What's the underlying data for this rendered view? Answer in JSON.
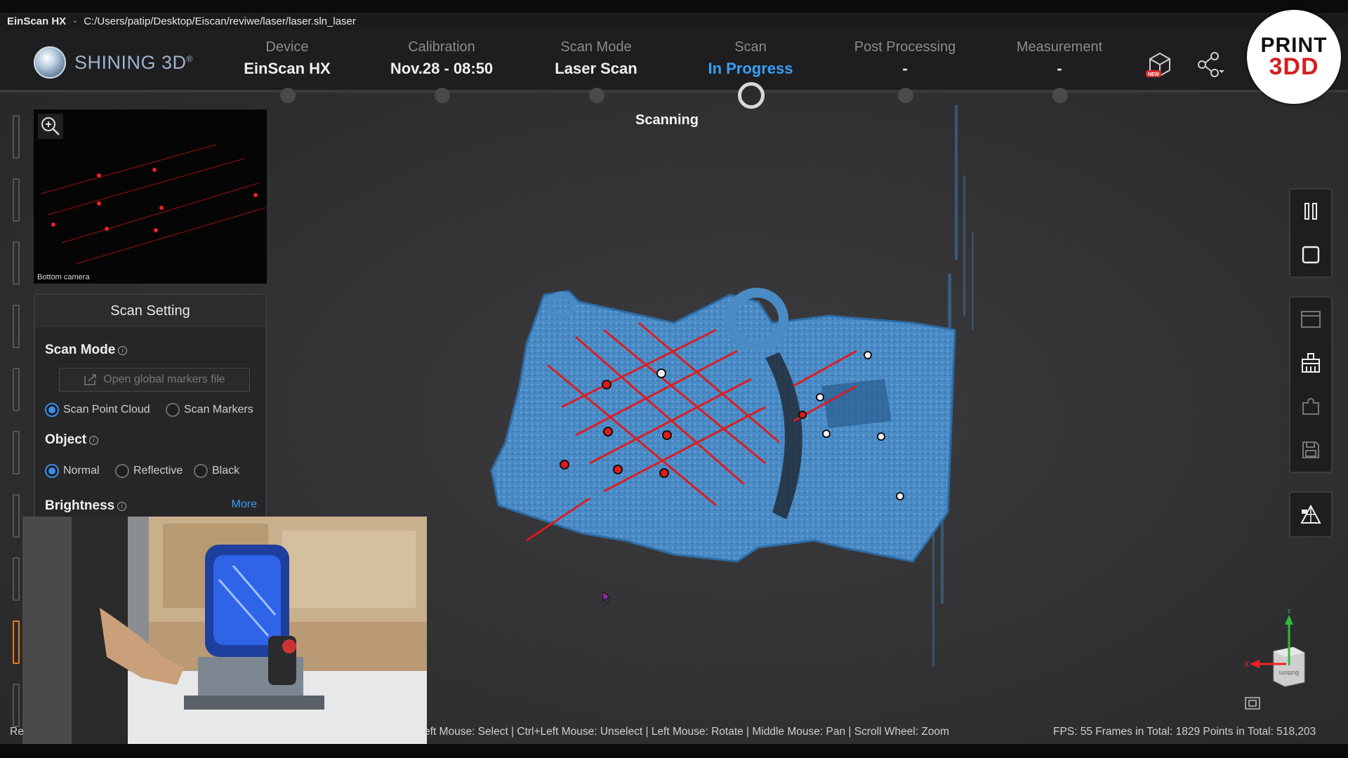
{
  "titlebar": {
    "app": "EinScan HX",
    "separator": "-",
    "path": "C:/Users/patip/Desktop/Eiscan/reviwe/laser/laser.sln_laser",
    "minimize": "—"
  },
  "brand": {
    "name": "SHINING 3D",
    "reg": "®"
  },
  "steps": [
    {
      "label": "Device",
      "value": "EinScan HX"
    },
    {
      "label": "Calibration",
      "value": "Nov.28 - 08:50"
    },
    {
      "label": "Scan Mode",
      "value": "Laser Scan"
    },
    {
      "label": "Scan",
      "value": "In Progress",
      "active": true
    },
    {
      "label": "Post Processing",
      "value": "-"
    },
    {
      "label": "Measurement",
      "value": "-"
    }
  ],
  "header_icons": [
    "model-new-icon",
    "share-icon"
  ],
  "header_badge": "NEW",
  "watermark": {
    "line1": "PRINT",
    "line2": "3DD"
  },
  "camera": {
    "caption": "Bottom camera"
  },
  "scan_setting": {
    "title": "Scan Setting",
    "scan_mode_label": "Scan Mode",
    "open_markers": "Open global markers file",
    "scan_mode_options": [
      "Scan Point Cloud",
      "Scan Markers"
    ],
    "scan_mode_selected": "Scan Point Cloud",
    "object_label": "Object",
    "object_options": [
      "Normal",
      "Reflective",
      "Black"
    ],
    "object_selected": "Normal",
    "brightness_label": "Brightness",
    "more": "More",
    "info_glyph": "i"
  },
  "viewport": {
    "status": "Scanning",
    "axes": {
      "x": "X",
      "y": "Y",
      "face": "Bottom"
    }
  },
  "status_bar": {
    "left_clip": "Re",
    "hints": "eft Mouse: Select | Ctrl+Left Mouse: Unselect | Left Mouse: Rotate | Middle Mouse: Pan | Scroll Wheel: Zoom",
    "stats": "FPS:  55   Frames in Total: 1829   Points in Total: 518,203"
  },
  "colors": {
    "accent": "#3a9ef5",
    "scan_blue": "#4f8fc9",
    "laser_red": "#e11a1a",
    "highlight": "#e8781e"
  }
}
